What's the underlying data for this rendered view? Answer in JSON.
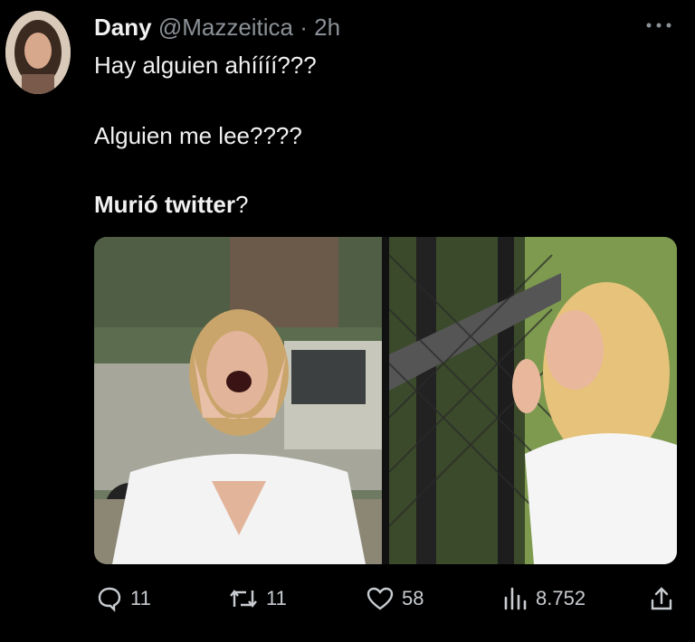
{
  "tweet": {
    "author_name": "Dany",
    "author_handle": "@Mazzeitica",
    "separator": "·",
    "time": "2h",
    "lines": [
      "Hay alguien ahíííí???",
      "Alguien me lee????"
    ],
    "last_line_bold": "Murió twitter",
    "last_line_rest": "?"
  },
  "actions": {
    "replies": "11",
    "retweets": "11",
    "likes": "58",
    "views": "8.752"
  },
  "icons": [
    "more-icon",
    "reply-icon",
    "retweet-icon",
    "like-icon",
    "views-icon",
    "share-icon"
  ],
  "colors": {
    "background": "#000000",
    "text": "#e7e9ea",
    "muted": "#8b9197"
  }
}
